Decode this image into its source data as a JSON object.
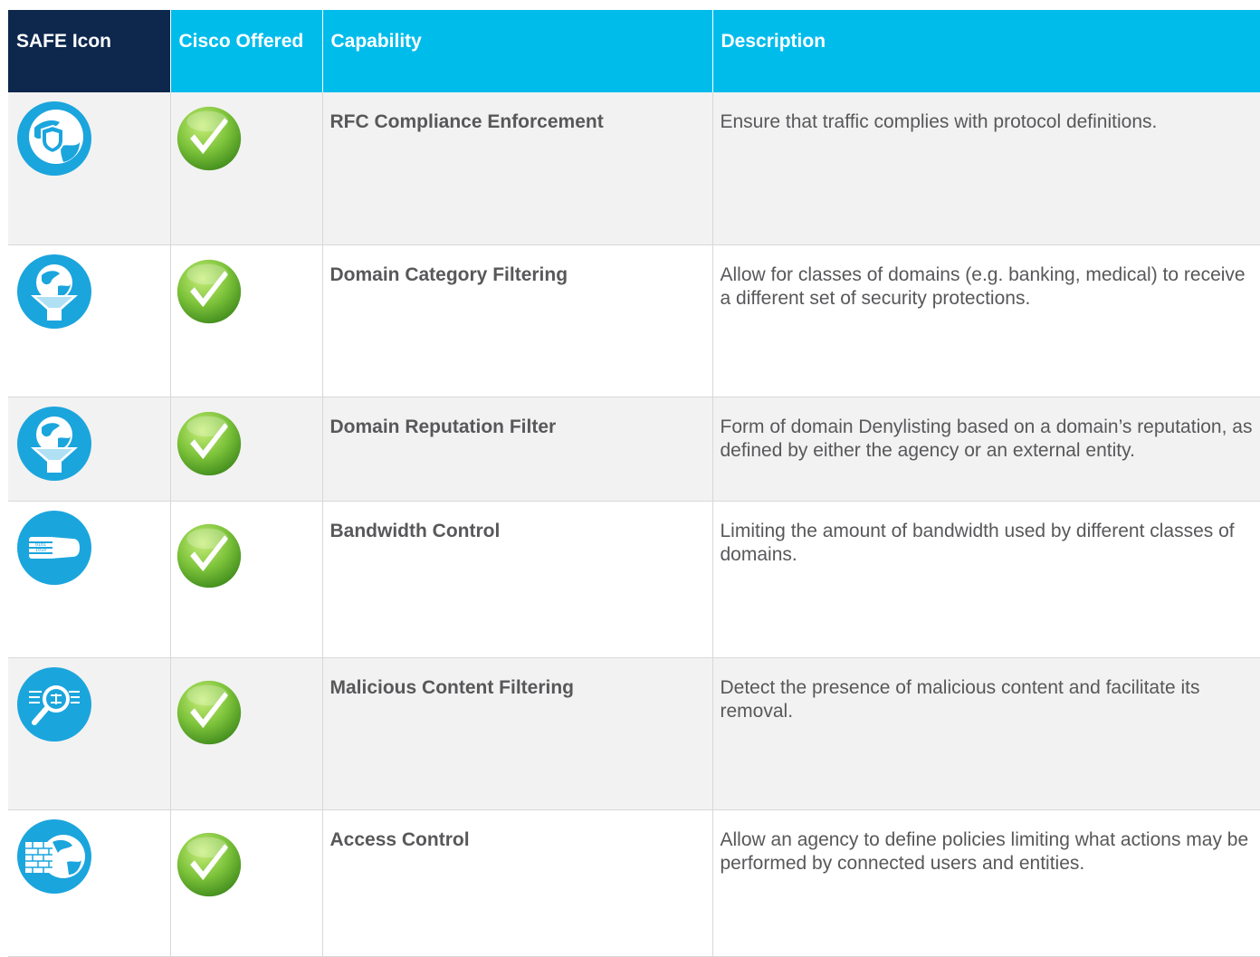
{
  "table": {
    "headers": {
      "safe_icon": "SAFE Icon",
      "cisco_offered": "Cisco Offered",
      "capability": "Capability",
      "description": "Description"
    },
    "colors": {
      "header_dark": "#0d274d",
      "header_cyan": "#00bceb",
      "icon_blue": "#1ba5dd",
      "check_green": "#6ab42d"
    },
    "rows": [
      {
        "icon": "globe-shield-icon",
        "offered": "check-icon",
        "capability": "RFC Compliance Enforcement",
        "description": "Ensure that traffic complies with protocol definitions."
      },
      {
        "icon": "globe-filter-icon",
        "offered": "check-icon",
        "capability": "Domain Category Filtering",
        "description": "Allow for classes of domains (e.g. banking, medical) to receive a different set of security protections."
      },
      {
        "icon": "globe-filter-icon",
        "offered": "check-icon",
        "capability": "Domain Reputation Filter",
        "description": "Form of domain Denylisting based on a domain’s reputation, as defined by either the agency or an external entity."
      },
      {
        "icon": "bandwidth-hand-icon",
        "offered": "check-icon",
        "capability": "Bandwidth Control",
        "description": "Limiting the amount of bandwidth used by different classes of domains."
      },
      {
        "icon": "magnifier-content-icon",
        "offered": "check-icon",
        "capability": "Malicious Content Filtering",
        "description": "Detect the presence of malicious content and facilitate its removal."
      },
      {
        "icon": "firewall-globe-icon",
        "offered": "check-icon",
        "capability": "Access Control",
        "description": "Allow an agency to define policies limiting what actions may be performed by connected users and entities."
      }
    ]
  }
}
